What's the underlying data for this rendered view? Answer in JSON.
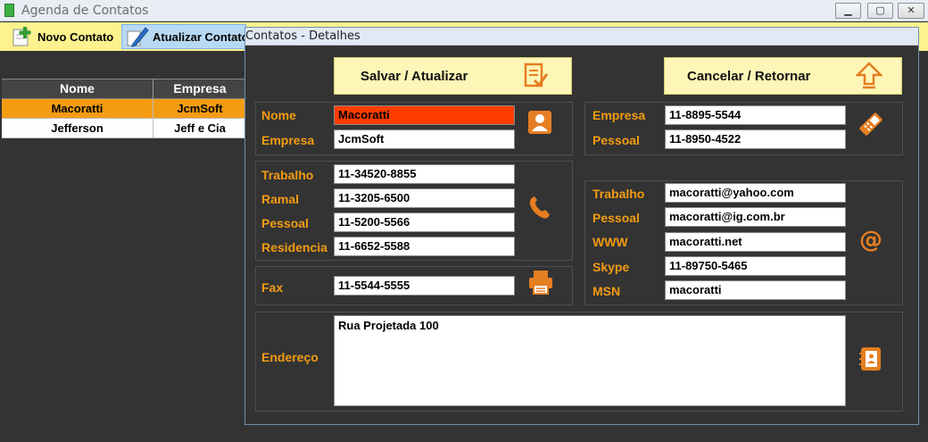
{
  "window": {
    "title": "Agenda de Contatos"
  },
  "toolbar": {
    "new_label": "Novo Contato",
    "update_label": "Atualizar Contato"
  },
  "grid": {
    "columns": [
      "Nome",
      "Empresa"
    ],
    "rows": [
      {
        "nome": "Macoratti",
        "empresa": "JcmSoft",
        "selected": true
      },
      {
        "nome": "Jefferson",
        "empresa": "Jeff e Cia",
        "selected": false
      }
    ]
  },
  "dialog": {
    "title": "Contatos - Detalhes",
    "save_label": "Salvar / Atualizar",
    "cancel_label": "Cancelar / Retornar",
    "nome": {
      "label": "Nome",
      "value": "Macoratti"
    },
    "empresa": {
      "label": "Empresa",
      "value": "JcmSoft"
    },
    "telefones": {
      "trabalho": {
        "label": "Trabalho",
        "value": "11-34520-8855"
      },
      "ramal": {
        "label": "Ramal",
        "value": "11-3205-6500"
      },
      "pessoal": {
        "label": "Pessoal",
        "value": "11-5200-5566"
      },
      "residencia": {
        "label": "Residencia",
        "value": "11-6652-5588"
      }
    },
    "fax": {
      "label": "Fax",
      "value": "11-5544-5555"
    },
    "celulares": {
      "empresa": {
        "label": "Empresa",
        "value": "11-8895-5544"
      },
      "pessoal": {
        "label": "Pessoal",
        "value": "11-8950-4522"
      }
    },
    "internet": {
      "trabalho": {
        "label": "Trabalho",
        "value": "macoratti@yahoo.com"
      },
      "pessoal": {
        "label": "Pessoal",
        "value": "macoratti@ig.com.br"
      },
      "www": {
        "label": "WWW",
        "value": "macoratti.net"
      },
      "skype": {
        "label": "Skype",
        "value": "11-89750-5465"
      },
      "msn": {
        "label": "MSN",
        "value": "macoratti"
      }
    },
    "endereco": {
      "label": "Endereço",
      "value": "Rua Projetada 100"
    }
  },
  "colors": {
    "background": "#333333",
    "accent_orange": "#f39c12",
    "toolbar_yellow": "#fdf28e",
    "button_yellow": "#fdf6b6",
    "selected_field": "#ff3d00"
  }
}
